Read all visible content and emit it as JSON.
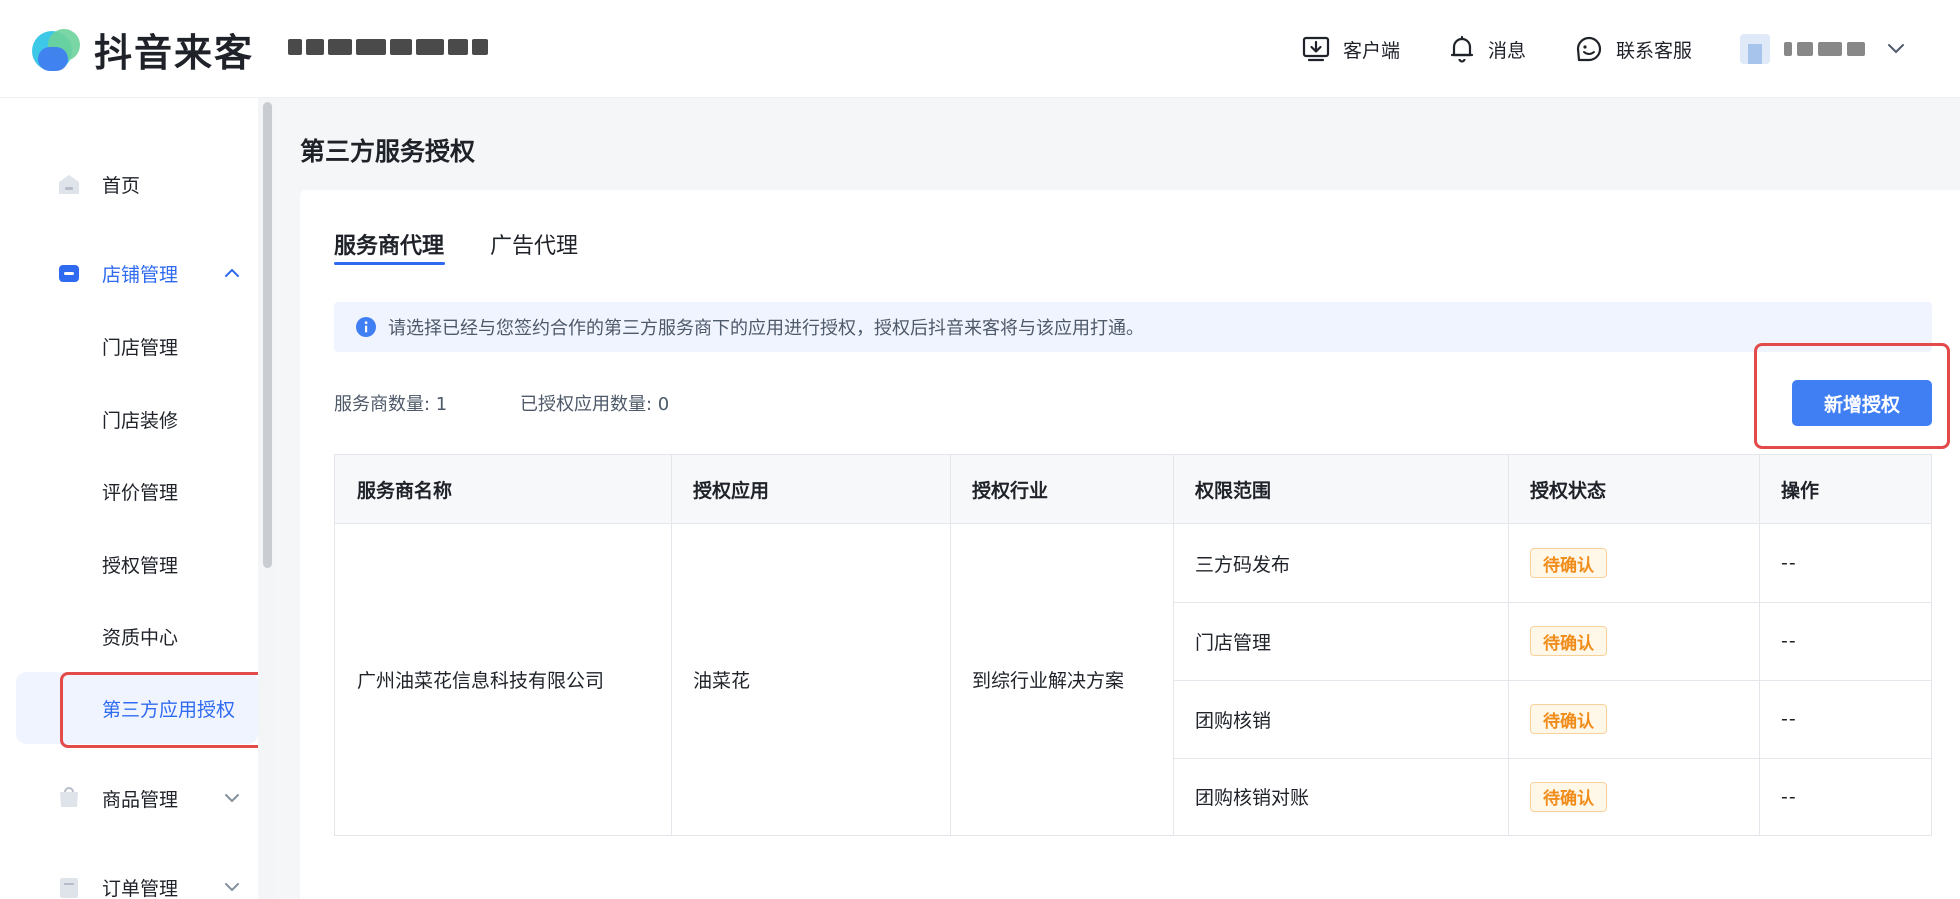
{
  "header": {
    "logo_text": "抖音来客",
    "actions": [
      {
        "label": "客户端",
        "icon": "download-icon"
      },
      {
        "label": "消息",
        "icon": "bell-icon"
      },
      {
        "label": "联系客服",
        "icon": "support-icon"
      }
    ]
  },
  "sidebar": {
    "items": [
      {
        "label": "首页",
        "icon": "home-icon"
      },
      {
        "label": "店铺管理",
        "icon": "store-icon",
        "expanded": true,
        "children": [
          "门店管理",
          "门店装修",
          "评价管理",
          "授权管理",
          "资质中心",
          "第三方应用授权"
        ],
        "selected": "第三方应用授权"
      },
      {
        "label": "商品管理",
        "icon": "goods-icon",
        "expanded": false
      },
      {
        "label": "订单管理",
        "icon": "order-icon",
        "expanded": false
      }
    ]
  },
  "page": {
    "title": "第三方服务授权",
    "tabs": [
      {
        "label": "服务商代理",
        "active": true
      },
      {
        "label": "广告代理",
        "active": false
      }
    ],
    "notice": "请选择已经与您签约合作的第三方服务商下的应用进行授权，授权后抖音来客将与该应用打通。",
    "stats": {
      "provider_count": "服务商数量: 1",
      "authorized_count": "已授权应用数量: 0"
    },
    "add_button": "新增授权"
  },
  "table": {
    "columns": [
      "服务商名称",
      "授权应用",
      "授权行业",
      "权限范围",
      "授权状态",
      "操作"
    ],
    "provider": "广州油菜花信息科技有限公司",
    "app": "油菜花",
    "industry": "到综行业解决方案",
    "rows": [
      {
        "scope": "三方码发布",
        "status": "待确认",
        "action": "--"
      },
      {
        "scope": "门店管理",
        "status": "待确认",
        "action": "--"
      },
      {
        "scope": "团购核销",
        "status": "待确认",
        "action": "--"
      },
      {
        "scope": "团购核销对账",
        "status": "待确认",
        "action": "--"
      }
    ]
  },
  "colors": {
    "primary": "#3f7ef3",
    "active_text": "#2f6bf0",
    "highlight": "#e34b4b",
    "badge_text": "#f08c1a",
    "badge_bg": "#fff7e8"
  }
}
